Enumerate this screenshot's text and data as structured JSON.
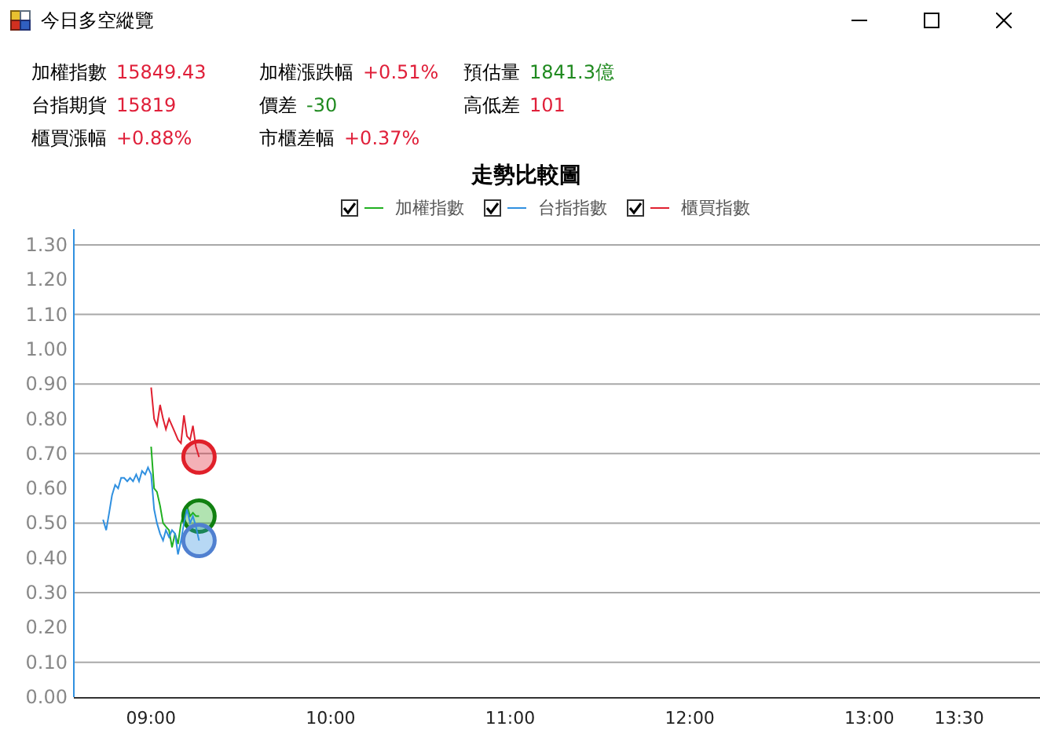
{
  "window": {
    "title": "今日多空縱覽"
  },
  "stats": [
    {
      "label": "加權指數",
      "value": "15849.43",
      "color": "#e0203a"
    },
    {
      "label": "加權漲跌幅",
      "value": "+0.51%",
      "color": "#e0203a"
    },
    {
      "label": "預估量",
      "value": "1841.3億",
      "color": "#208a20"
    },
    {
      "label": "台指期貨",
      "value": "15819",
      "color": "#e0203a"
    },
    {
      "label": "價差",
      "value": "-30",
      "color": "#208a20"
    },
    {
      "label": "高低差",
      "value": "101",
      "color": "#e0203a"
    },
    {
      "label": "櫃買漲幅",
      "value": "+0.88%",
      "color": "#e0203a"
    },
    {
      "label": "市櫃差幅",
      "value": "+0.37%",
      "color": "#e0203a"
    }
  ],
  "chart": {
    "chart_data": {
      "type": "line",
      "title": "走勢比較圖",
      "x": [
        8.733,
        8.75,
        8.767,
        8.783,
        8.8,
        8.817,
        8.833,
        8.85,
        8.867,
        8.883,
        8.9,
        8.917,
        8.933,
        8.95,
        8.967,
        8.983,
        9,
        9.017,
        9.033,
        9.05,
        9.067,
        9.083,
        9.1,
        9.117,
        9.133,
        9.15,
        9.167,
        9.183,
        9.2,
        9.217,
        9.233,
        9.25,
        9.267
      ],
      "series": [
        {
          "name": "加權指數",
          "color": "#20b020",
          "values": [
            null,
            null,
            null,
            null,
            null,
            null,
            null,
            null,
            null,
            null,
            null,
            null,
            null,
            null,
            null,
            null,
            0.72,
            0.6,
            0.59,
            0.55,
            0.5,
            0.49,
            0.48,
            0.43,
            0.47,
            0.44,
            0.5,
            0.53,
            0.55,
            0.52,
            0.53,
            0.52,
            0.52
          ]
        },
        {
          "name": "台指指數",
          "color": "#3090e0",
          "values": [
            0.51,
            0.48,
            0.53,
            0.58,
            0.61,
            0.6,
            0.63,
            0.63,
            0.62,
            0.63,
            0.62,
            0.64,
            0.62,
            0.65,
            0.64,
            0.66,
            0.64,
            0.54,
            0.5,
            0.47,
            0.45,
            0.48,
            0.46,
            0.48,
            0.47,
            0.41,
            0.45,
            0.5,
            0.54,
            0.5,
            0.52,
            0.49,
            0.45
          ]
        },
        {
          "name": "櫃買指數",
          "color": "#e02030",
          "values": [
            null,
            null,
            null,
            null,
            null,
            null,
            null,
            null,
            null,
            null,
            null,
            null,
            null,
            null,
            null,
            null,
            0.89,
            0.8,
            0.78,
            0.84,
            0.8,
            0.77,
            0.8,
            0.78,
            0.76,
            0.74,
            0.73,
            0.81,
            0.75,
            0.74,
            0.78,
            0.72,
            0.69
          ]
        }
      ],
      "xlim": [
        8.57,
        13.95
      ],
      "ylim": [
        0,
        1.3
      ],
      "grid": true,
      "xticks": [
        {
          "value": 9,
          "label": "09:00"
        },
        {
          "value": 10,
          "label": "10:00"
        },
        {
          "value": 11,
          "label": "11:00"
        },
        {
          "value": 12,
          "label": "12:00"
        },
        {
          "value": 13,
          "label": "13:00"
        },
        {
          "value": 13.5,
          "label": "13:30"
        }
      ],
      "yticks": [
        {
          "value": 0,
          "label": "0.00"
        },
        {
          "value": 0.1,
          "label": "0.10"
        },
        {
          "value": 0.2,
          "label": "0.20"
        },
        {
          "value": 0.3,
          "label": "0.30"
        },
        {
          "value": 0.4,
          "label": "0.40"
        },
        {
          "value": 0.5,
          "label": "0.50"
        },
        {
          "value": 0.6,
          "label": "0.60"
        },
        {
          "value": 0.7,
          "label": "0.70"
        },
        {
          "value": 0.8,
          "label": "0.80"
        },
        {
          "value": 0.9,
          "label": "0.90"
        },
        {
          "value": 1.0,
          "label": "1.00"
        },
        {
          "value": 1.1,
          "label": "1.10"
        },
        {
          "value": 1.2,
          "label": "1.20"
        },
        {
          "value": 1.3,
          "label": "1.30"
        }
      ]
    },
    "legend": [
      {
        "checked": true
      },
      {
        "checked": true
      },
      {
        "checked": true
      }
    ]
  }
}
